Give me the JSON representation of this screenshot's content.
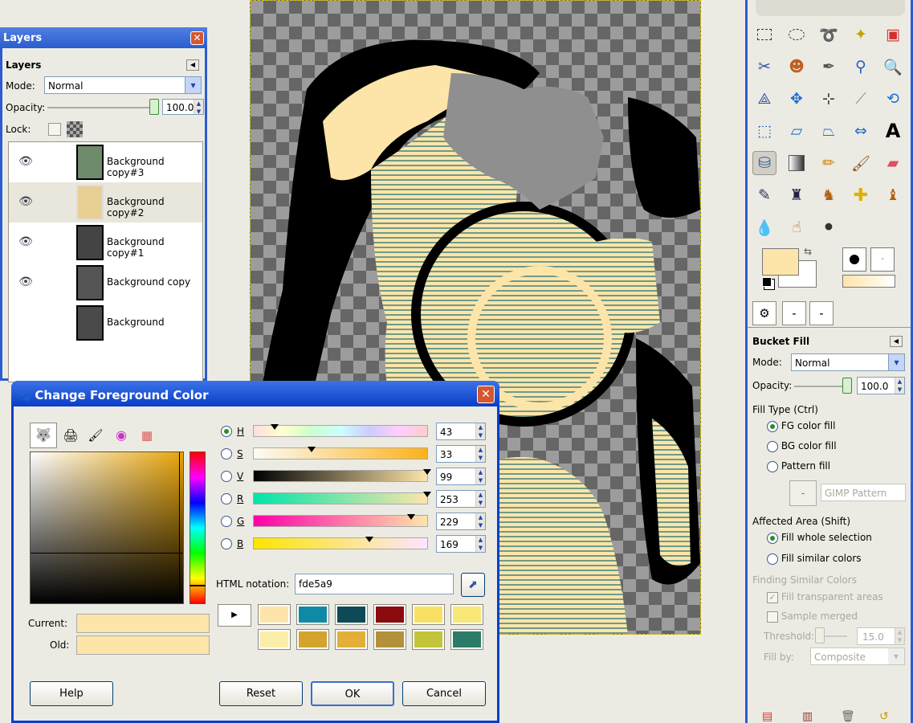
{
  "layers_panel": {
    "window_title": "Layers",
    "panel_title": "Layers",
    "mode_label": "Mode:",
    "mode_value": "Normal",
    "opacity_label": "Opacity:",
    "opacity_value": "100.0",
    "lock_label": "Lock:",
    "layers": [
      {
        "name": "Background copy#3",
        "visible": true
      },
      {
        "name": "Background copy#2",
        "visible": true
      },
      {
        "name": "Background copy#1",
        "visible": true
      },
      {
        "name": "Background copy",
        "visible": true
      },
      {
        "name": "Background",
        "visible": false
      }
    ]
  },
  "dialog": {
    "title": "Change Foreground Color",
    "channels": [
      {
        "key": "H",
        "value": "43",
        "selected": true
      },
      {
        "key": "S",
        "value": "33",
        "selected": false
      },
      {
        "key": "V",
        "value": "99",
        "selected": false
      },
      {
        "key": "R",
        "value": "253",
        "selected": false
      },
      {
        "key": "G",
        "value": "229",
        "selected": false
      },
      {
        "key": "B",
        "value": "169",
        "selected": false
      }
    ],
    "channel_fractions": [
      0.12,
      0.33,
      0.99,
      0.99,
      0.9,
      0.66
    ],
    "html_label": "HTML notation:",
    "html_value": "fde5a9",
    "current_label": "Current:",
    "old_label": "Old:",
    "current_color": "#fde5a9",
    "history_colors": [
      "#fde5a9",
      "#0f8aa6",
      "#0e4a55",
      "#8a0a0d",
      "#f8e063",
      "#f7e878",
      "#fbeea8",
      "#d3a42c",
      "#e3b037",
      "#b3903a",
      "#c4c43a",
      "#2b7b68"
    ],
    "help_button": "Help",
    "reset_button": "Reset",
    "ok_button": "OK",
    "cancel_button": "Cancel"
  },
  "toolbox": {
    "fg_color": "#fde5a9",
    "bg_color": "#ffffff",
    "tool_options_title": "Bucket Fill",
    "mode_label": "Mode:",
    "mode_value": "Normal",
    "opacity_label": "Opacity:",
    "opacity_value": "100.0",
    "fill_type_label": "Fill Type  (Ctrl)",
    "fill_fg": "FG color fill",
    "fill_bg": "BG color fill",
    "fill_pattern": "Pattern fill",
    "pattern_name": "GIMP Pattern",
    "affected_label": "Affected Area  (Shift)",
    "fill_whole": "Fill whole selection",
    "fill_similar": "Fill similar colors",
    "finding_label": "Finding Similar Colors",
    "fill_transparent": "Fill transparent areas",
    "sample_merged": "Sample merged",
    "threshold_label": "Threshold:",
    "threshold_value": "15.0",
    "fill_by_label": "Fill by:",
    "fill_by_value": "Composite"
  }
}
